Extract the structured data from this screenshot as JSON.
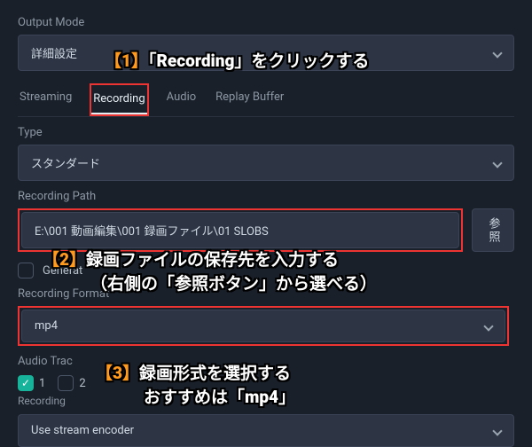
{
  "output_mode": {
    "label": "Output Mode",
    "value": "詳細設定"
  },
  "tabs": {
    "streaming": "Streaming",
    "recording": "Recording",
    "audio": "Audio",
    "replay_buffer": "Replay Buffer"
  },
  "type": {
    "label": "Type",
    "value": "スタンダード"
  },
  "path": {
    "label": "Recording Path",
    "value": "E:\\001 動画編集\\001 録画ファイル\\01 SLOBS",
    "browse": "参照"
  },
  "generate_checkbox": {
    "label": "Generat"
  },
  "format": {
    "label": "Recording Format",
    "value": "mp4"
  },
  "audio_track": {
    "label": "Audio Trac",
    "opt1": "1",
    "opt2": "2",
    "sublabel": "Recording"
  },
  "encoder": {
    "value": "Use stream encoder"
  },
  "annotations": {
    "a1_num": "【1】",
    "a1_text": "「Recording」をクリックする",
    "a2_num": "【2】",
    "a2_line1": "録画ファイルの保存先を入力する",
    "a2_line2": "（右側の「参照ボタン」から選べる）",
    "a3_num": "【3】",
    "a3_line1": "録画形式を選択する",
    "a3_line2": "おすすめは「mp4」"
  }
}
